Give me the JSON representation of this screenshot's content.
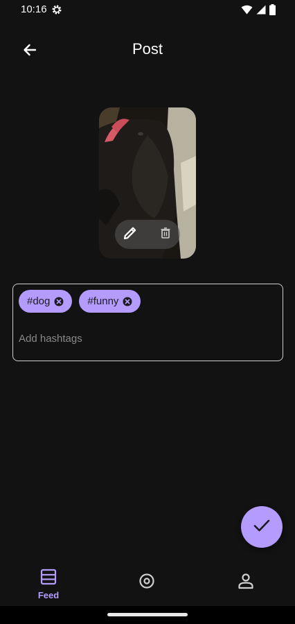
{
  "status_bar": {
    "time": "10:16",
    "icons": [
      "settings-gear-icon",
      "wifi-icon",
      "signal-icon",
      "battery-icon"
    ]
  },
  "app_bar": {
    "title": "Post",
    "back_icon": "arrow-back-icon"
  },
  "preview": {
    "actions": [
      "edit-pencil-icon",
      "delete-trash-icon"
    ]
  },
  "hashtags": {
    "chips": [
      "#dog",
      "#funny"
    ],
    "chip_remove_icon": "cancel-circle-icon",
    "input_value": "",
    "placeholder": "Add hashtags"
  },
  "fab": {
    "icon": "check-icon"
  },
  "bottom_nav": {
    "items": [
      {
        "label": "Feed",
        "icon": "feed-list-icon",
        "selected": true
      },
      {
        "label": "",
        "icon": "explore-target-icon",
        "selected": false
      },
      {
        "label": "",
        "icon": "person-icon",
        "selected": false
      }
    ]
  },
  "colors": {
    "background": "#121212",
    "accent": "#b49cff",
    "chip_text": "#1d1b22",
    "outline": "#cfcfcf",
    "placeholder": "#8a8a8a"
  }
}
